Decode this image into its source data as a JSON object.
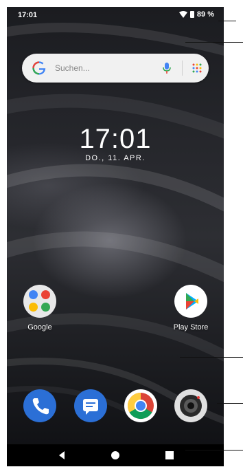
{
  "status_bar": {
    "time": "17:01",
    "battery": "89 %"
  },
  "search_bar": {
    "placeholder": "Suchen..."
  },
  "lock_clock": {
    "time": "17:01",
    "date": "DO., 11. APR."
  },
  "home_apps": [
    {
      "label": "Google",
      "icon": "google-folder-icon"
    },
    {
      "label": "Play Store",
      "icon": "play-store-icon"
    }
  ],
  "dock": [
    "phone-icon",
    "messages-icon",
    "chrome-icon",
    "camera-icon"
  ],
  "nav_bar": [
    "back-icon",
    "home-icon",
    "recents-icon"
  ],
  "colors": {
    "accent_blue": "#1a73e8",
    "search_bg": "#f1f1f1",
    "navbar_bg": "#000000"
  }
}
